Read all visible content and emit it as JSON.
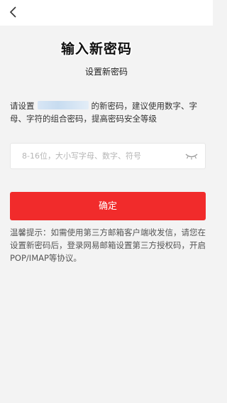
{
  "topbar": {
    "back_icon": "chevron-left-icon"
  },
  "overlay": {
    "title": "输入新密码"
  },
  "page": {
    "title": "设置新密码"
  },
  "description": {
    "before": "请设置",
    "after": "的新密码，建议使用数字、字母、字符的组合密码，提高密码安全等级"
  },
  "password": {
    "placeholder": "8-16位，大小写字母、数字、符号",
    "value": "",
    "toggle_icon": "eye-closed-icon"
  },
  "confirm": {
    "label": "确定"
  },
  "tip": {
    "text": "温馨提示：如需使用第三方邮箱客户端收发信，请您在设置新密码后，登录网易邮箱设置第三方授权码，开启POP/IMAP等协议。"
  },
  "colors": {
    "accent": "#f12b2b",
    "background": "#f3f3f3"
  }
}
